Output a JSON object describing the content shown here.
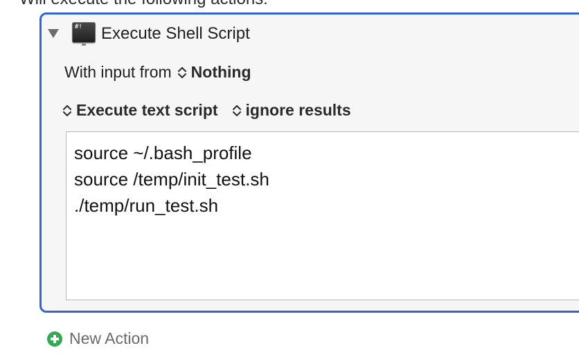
{
  "caption": "Will execute the following actions:",
  "action": {
    "title": "Execute Shell Script",
    "icon": "terminal-icon",
    "input_label": "With input from",
    "input_value": "Nothing",
    "script_type": "Execute text script",
    "results_mode": "ignore results",
    "script_lines": [
      "source ~/.bash_profile",
      "source /temp/init_test.sh",
      "./temp/run_test.sh"
    ]
  },
  "footer": {
    "new_action_label": "New Action"
  },
  "colors": {
    "selection_border": "#2f63d7",
    "add_icon": "#34a853"
  }
}
